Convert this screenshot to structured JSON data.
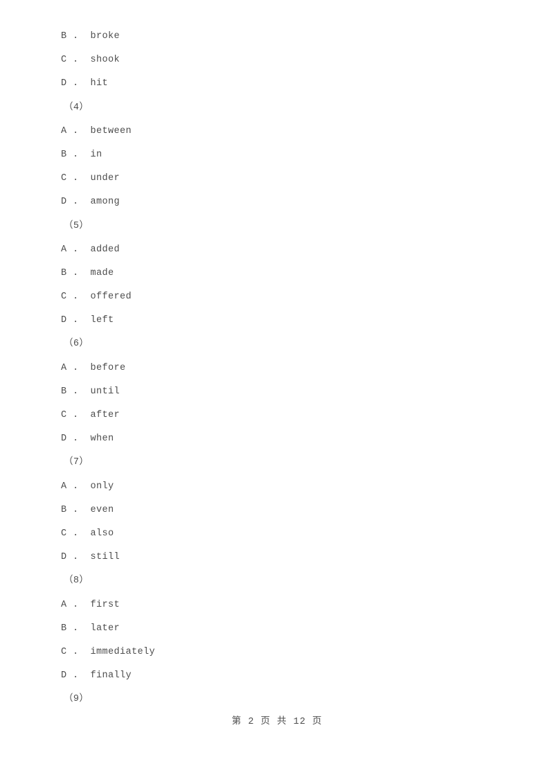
{
  "document": {
    "page_background": "#ffffff",
    "text_color": "#4d4d4d"
  },
  "blocks": [
    {
      "type": "option",
      "label": "B",
      "separator": " . ",
      "text": "broke",
      "line": "B .  broke"
    },
    {
      "type": "option",
      "label": "C",
      "separator": " . ",
      "text": "shook",
      "line": "C .  shook"
    },
    {
      "type": "option",
      "label": "D",
      "separator": " . ",
      "text": "hit",
      "line": "D .  hit"
    },
    {
      "type": "qnum",
      "number": "4",
      "line": "（4）"
    },
    {
      "type": "option",
      "label": "A",
      "separator": " . ",
      "text": "between",
      "line": "A .  between"
    },
    {
      "type": "option",
      "label": "B",
      "separator": " . ",
      "text": "in",
      "line": "B .  in"
    },
    {
      "type": "option",
      "label": "C",
      "separator": " . ",
      "text": "under",
      "line": "C .  under"
    },
    {
      "type": "option",
      "label": "D",
      "separator": " . ",
      "text": "among",
      "line": "D .  among"
    },
    {
      "type": "qnum",
      "number": "5",
      "line": "（5）"
    },
    {
      "type": "option",
      "label": "A",
      "separator": " . ",
      "text": "added",
      "line": "A .  added"
    },
    {
      "type": "option",
      "label": "B",
      "separator": " . ",
      "text": "made",
      "line": "B .  made"
    },
    {
      "type": "option",
      "label": "C",
      "separator": " . ",
      "text": "offered",
      "line": "C .  offered"
    },
    {
      "type": "option",
      "label": "D",
      "separator": " . ",
      "text": "left",
      "line": "D .  left"
    },
    {
      "type": "qnum",
      "number": "6",
      "line": "（6）"
    },
    {
      "type": "option",
      "label": "A",
      "separator": " . ",
      "text": "before",
      "line": "A .  before"
    },
    {
      "type": "option",
      "label": "B",
      "separator": " . ",
      "text": "until",
      "line": "B .  until"
    },
    {
      "type": "option",
      "label": "C",
      "separator": " . ",
      "text": "after",
      "line": "C .  after"
    },
    {
      "type": "option",
      "label": "D",
      "separator": " . ",
      "text": "when",
      "line": "D .  when"
    },
    {
      "type": "qnum",
      "number": "7",
      "line": "（7）"
    },
    {
      "type": "option",
      "label": "A",
      "separator": " . ",
      "text": "only",
      "line": "A .  only"
    },
    {
      "type": "option",
      "label": "B",
      "separator": " . ",
      "text": "even",
      "line": "B .  even"
    },
    {
      "type": "option",
      "label": "C",
      "separator": " . ",
      "text": "also",
      "line": "C .  also"
    },
    {
      "type": "option",
      "label": "D",
      "separator": " . ",
      "text": "still",
      "line": "D .  still"
    },
    {
      "type": "qnum",
      "number": "8",
      "line": "（8）"
    },
    {
      "type": "option",
      "label": "A",
      "separator": " . ",
      "text": "first",
      "line": "A .  first"
    },
    {
      "type": "option",
      "label": "B",
      "separator": " . ",
      "text": "later",
      "line": "B .  later"
    },
    {
      "type": "option",
      "label": "C",
      "separator": " . ",
      "text": "immediately",
      "line": "C .  immediately"
    },
    {
      "type": "option",
      "label": "D",
      "separator": " . ",
      "text": "finally",
      "line": "D .  finally"
    },
    {
      "type": "qnum",
      "number": "9",
      "line": "（9）"
    }
  ],
  "footer": {
    "text": "第 2 页 共 12 页",
    "current_page": "2",
    "total_pages": "12"
  }
}
